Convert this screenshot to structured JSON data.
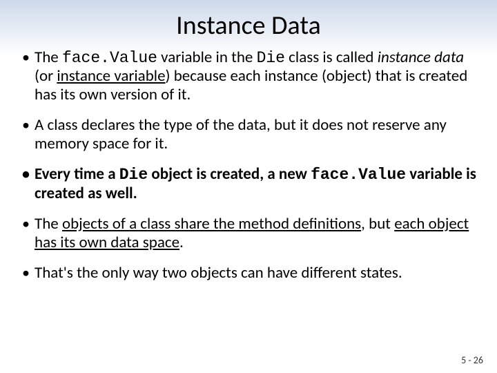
{
  "title": "Instance Data",
  "bullet1": {
    "t1": "The ",
    "code1": "face.Value",
    "t2": " variable in the ",
    "code2": "Die",
    "t3": " class is called ",
    "it1": "instance data",
    "t4": " (or ",
    "u1": "instance variable",
    "t5": ") because each instance (object) that is created has its own version of it."
  },
  "bullet2": "A class declares the type of the data, but it does not reserve any memory space for it.",
  "bullet3": {
    "t1": "Every time a ",
    "code1": "Die",
    "t2": " object is created, a new ",
    "code2": "face.Value",
    "t3": " variable is created as well."
  },
  "bullet4": {
    "t1": "The ",
    "u1": "objects of a class share the method definitions",
    "t2": ", but ",
    "u2": "each object has its own data space",
    "t3": "."
  },
  "bullet5": "That's the only way two objects can have different states.",
  "page": "5 - 26"
}
